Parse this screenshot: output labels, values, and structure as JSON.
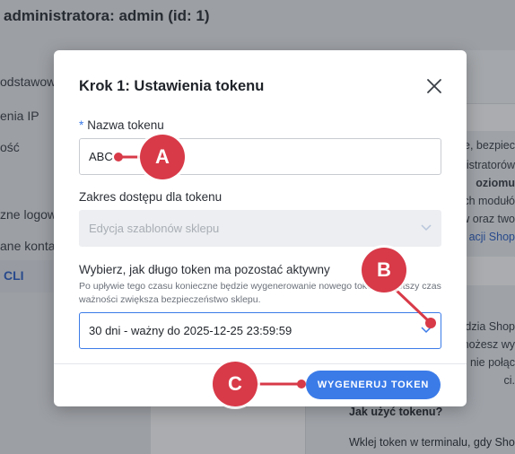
{
  "background": {
    "page_title": "administratora: admin (id: 1)",
    "nav_items": [
      "odstawow",
      "enia IP",
      "ość",
      "zne logow",
      "ane konta",
      "CLI"
    ],
    "card_lines": [
      "dzia Shop",
      "nożesz wy",
      "nie połąc",
      "ci."
    ],
    "card_top_lines": [
      "e, bezpiec",
      "istratorów",
      "oziomu",
      "ch modułó",
      "w oraz two",
      "acji Shop"
    ],
    "how_to_heading": "Jak użyć tokenu?",
    "how_to_text": "Wklej token w terminalu, gdy Sho"
  },
  "modal": {
    "title": "Krok 1: Ustawienia tokenu",
    "close_icon": "close-icon",
    "token_name": {
      "required_mark": "*",
      "label": "Nazwa tokenu",
      "value": "ABC"
    },
    "scope": {
      "label": "Zakres dostępu dla tokenu",
      "value": "Edycja szablonów sklepu"
    },
    "validity": {
      "label": "Wybierz, jak długo token ma pozostać aktywny",
      "hint": "Po upływie tego czasu konieczne będzie wygenerowanie nowego tokenu. Krótszy czas ważności zwiększa bezpieczeństwo sklepu.",
      "value": "30 dni - ważny do 2025-12-25 23:59:59"
    },
    "generate_label": "WYGENERUJ TOKEN"
  },
  "callouts": {
    "a": "A",
    "b": "B",
    "c": "C",
    "color": "#d83a48"
  },
  "colors": {
    "accent": "#3b7be8",
    "overlay": "rgba(32,36,44,0.38)"
  }
}
